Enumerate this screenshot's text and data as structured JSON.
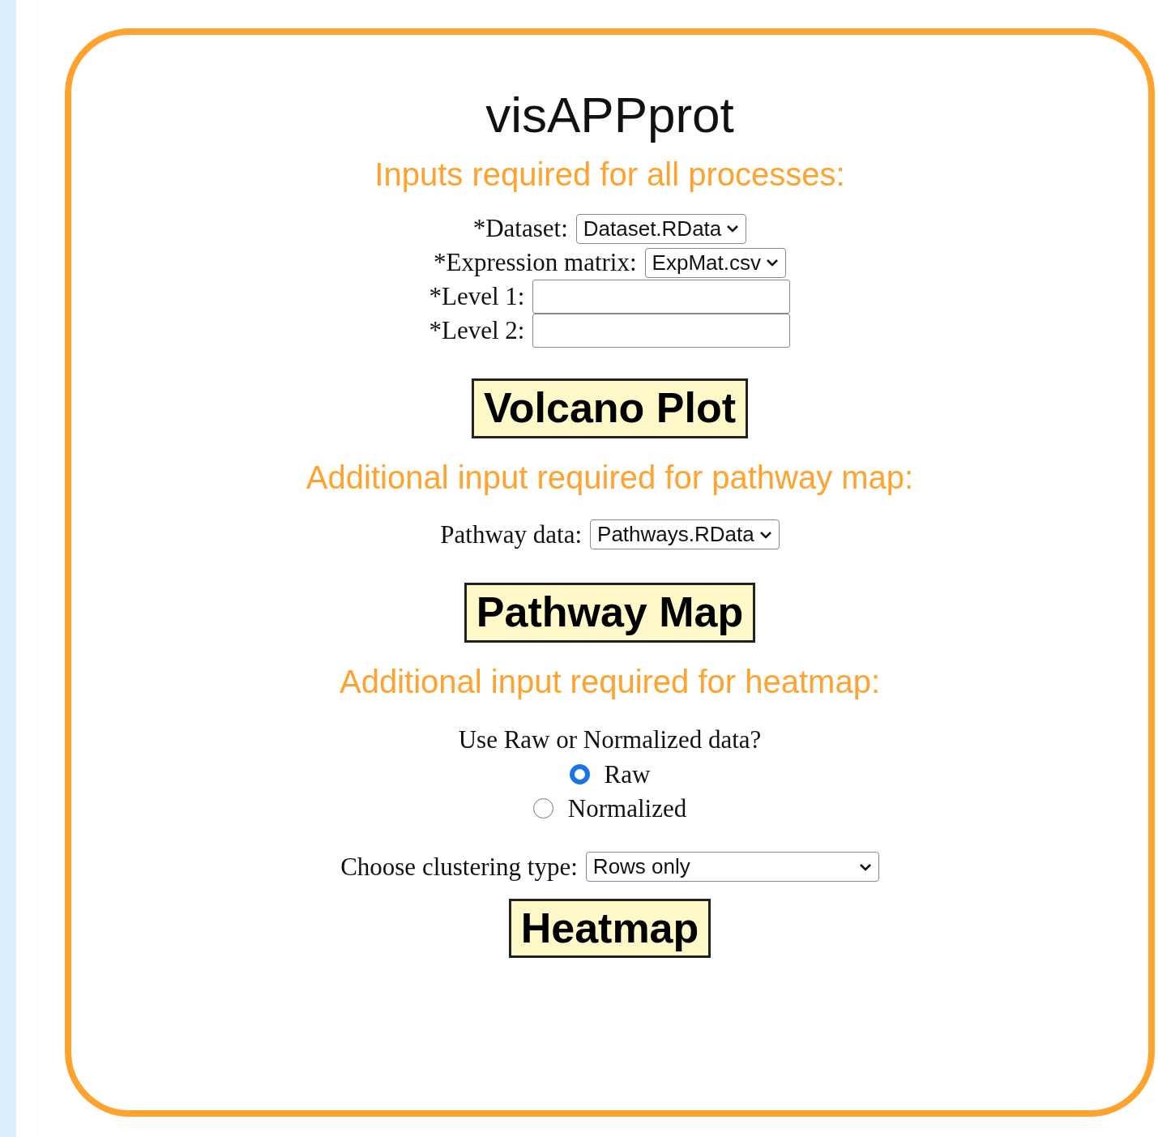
{
  "title": "visAPPprot",
  "sections": [
    {
      "heading": "Inputs required for all processes:",
      "fields": [
        {
          "kind": "select",
          "label": "*Dataset:",
          "value": "Dataset.RData"
        },
        {
          "kind": "select",
          "label": "*Expression matrix:",
          "value": "ExpMat.csv"
        },
        {
          "kind": "text",
          "label": "*Level 1:"
        },
        {
          "kind": "text",
          "label": "*Level 2:"
        }
      ],
      "button": "Volcano Plot"
    },
    {
      "heading": "Additional input required for pathway map:",
      "fields": [
        {
          "kind": "select",
          "label": "Pathway data:",
          "value": "Pathways.RData"
        }
      ],
      "button": "Pathway Map"
    },
    {
      "heading": "Additional input required for heatmap:",
      "fields": [
        {
          "kind": "radio_group",
          "label": "Use Raw or Normalized data?",
          "options": [
            {
              "label": "Raw",
              "selected": true
            },
            {
              "label": "Normalized",
              "selected": false
            }
          ]
        },
        {
          "kind": "select",
          "label": "Choose clustering type:",
          "value": "Rows only",
          "wide": true
        }
      ],
      "button": "Heatmap"
    }
  ]
}
